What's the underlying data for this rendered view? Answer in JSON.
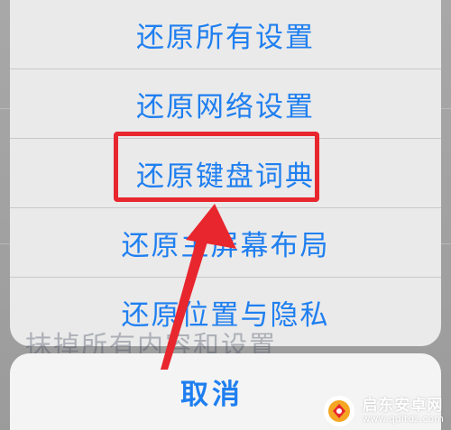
{
  "action_sheet": {
    "options": [
      {
        "label": "还原所有设置"
      },
      {
        "label": "还原网络设置"
      },
      {
        "label": "还原键盘词典"
      },
      {
        "label": "还原主屏幕布局"
      },
      {
        "label": "还原位置与隐私"
      }
    ],
    "cancel_label": "取消"
  },
  "background": {
    "partial_text": "抹掉所有内容和设置"
  },
  "annotation": {
    "highlighted_option": "还原键盘词典",
    "color": "#e8262e"
  },
  "watermark": {
    "title": "启东安卓网",
    "url": "www.qdltdz.com"
  },
  "colors": {
    "accent": "#1f7ff0",
    "sheet_bg": "#eaeaea",
    "dim_bg": "#9f9f9f"
  }
}
